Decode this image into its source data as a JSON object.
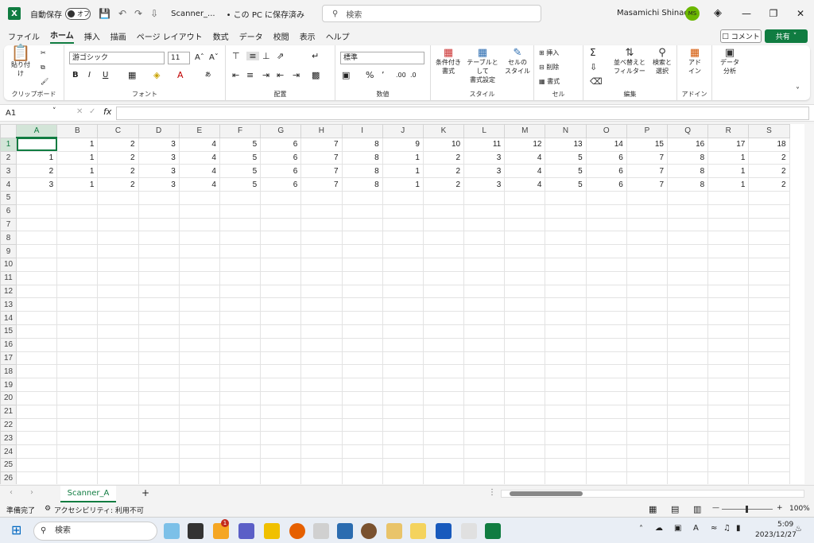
{
  "titlebar": {
    "autosave_label": "自動保存",
    "autosave_state": "オフ",
    "filename": "Scanner_...",
    "location": "• この PC に保存済み",
    "search_placeholder": "検索",
    "user_name": "Masamichi Shinada",
    "user_initials": "MS"
  },
  "menu": {
    "items": [
      "ファイル",
      "ホーム",
      "挿入",
      "描画",
      "ページ レイアウト",
      "数式",
      "データ",
      "校閲",
      "表示",
      "ヘルプ"
    ],
    "active": "ホーム",
    "comment_label": "コメント",
    "share_label": "共有"
  },
  "ribbon": {
    "clipboard": {
      "label": "クリップボード",
      "paste": "貼り付け"
    },
    "font": {
      "label": "フォント",
      "font_name": "游ゴシック",
      "font_size": "11"
    },
    "alignment": {
      "label": "配置"
    },
    "number": {
      "label": "数値",
      "format": "標準"
    },
    "styles": {
      "label": "スタイル",
      "cond_1": "条件付き",
      "cond_2": "書式",
      "table_1": "テーブルとして",
      "table_2": "書式設定",
      "cell_1": "セルの",
      "cell_2": "スタイル"
    },
    "cells": {
      "label": "セル",
      "insert": "挿入",
      "delete": "削除",
      "format": "書式"
    },
    "editing": {
      "label": "編集",
      "sort_1": "並べ替えと",
      "sort_2": "フィルター",
      "find_1": "検索と",
      "find_2": "選択"
    },
    "addins": {
      "label": "アドイン",
      "btn_1": "アド",
      "btn_2": "イン"
    },
    "analysis": {
      "btn_1": "データ",
      "btn_2": "分析"
    }
  },
  "formula": {
    "name_box": "A1",
    "fx": "fx",
    "content": ""
  },
  "sheet": {
    "columns": [
      "A",
      "B",
      "C",
      "D",
      "E",
      "F",
      "G",
      "H",
      "I",
      "J",
      "K",
      "L",
      "M",
      "N",
      "O",
      "P",
      "Q",
      "R",
      "S"
    ],
    "row_count": 26,
    "rows": [
      [
        "",
        "1",
        "2",
        "3",
        "4",
        "5",
        "6",
        "7",
        "8",
        "9",
        "10",
        "11",
        "12",
        "13",
        "14",
        "15",
        "16",
        "17",
        "18"
      ],
      [
        "1",
        "1",
        "2",
        "3",
        "4",
        "5",
        "6",
        "7",
        "8",
        "1",
        "2",
        "3",
        "4",
        "5",
        "6",
        "7",
        "8",
        "1",
        "2"
      ],
      [
        "2",
        "1",
        "2",
        "3",
        "4",
        "5",
        "6",
        "7",
        "8",
        "1",
        "2",
        "3",
        "4",
        "5",
        "6",
        "7",
        "8",
        "1",
        "2"
      ],
      [
        "3",
        "1",
        "2",
        "3",
        "4",
        "5",
        "6",
        "7",
        "8",
        "1",
        "2",
        "3",
        "4",
        "5",
        "6",
        "7",
        "8",
        "1",
        "2"
      ]
    ]
  },
  "tabs": {
    "sheet_name": "Scanner_A",
    "add": "+"
  },
  "status": {
    "ready": "準備完了",
    "accessibility": "アクセシビリティ: 利用不可",
    "zoom": "100%"
  },
  "taskbar": {
    "search": "検索",
    "time": "5:09",
    "date": "2023/12/27",
    "notif_badge": "1"
  }
}
